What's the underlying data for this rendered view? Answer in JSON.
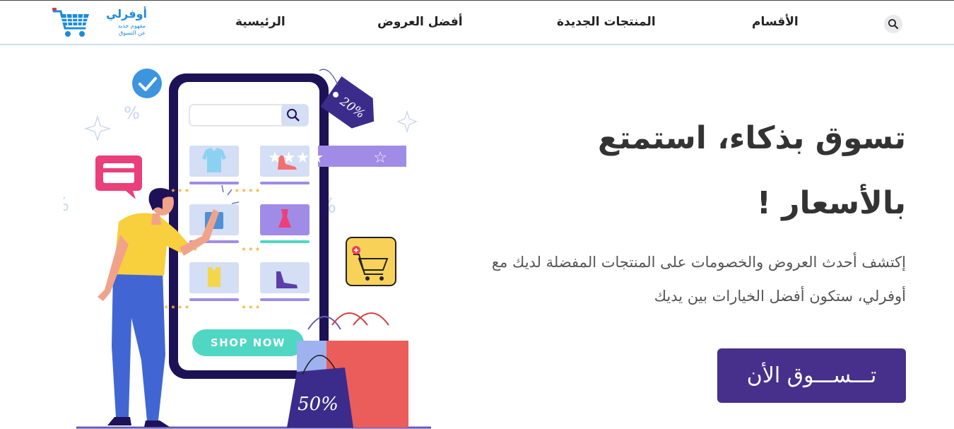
{
  "header": {
    "logo": {
      "title": "أوفرلي",
      "tagline_line1": "مفهوم جديد",
      "tagline_line2": "عن التسوق"
    },
    "nav": [
      {
        "label": "الرئيسية"
      },
      {
        "label": "أفضل العروض"
      },
      {
        "label": "المنتجات الجديدة"
      },
      {
        "label": "الأقسام"
      }
    ]
  },
  "hero": {
    "title": "تسوق بذكاء، استمتع بالأسعار !",
    "description": "إكتشف أحدث العروض والخصومات على المنتجات المفضلة لديك مع أوفرلي، ستكون أفضل الخيارات بين يديك",
    "cta_label": "تـــســـوق الأن"
  },
  "illustration": {
    "shop_now_label": "SHOP NOW",
    "discount_tag": "20%",
    "bag_label": "50%",
    "rating_stars": 4
  },
  "colors": {
    "brand_blue": "#1d8bdc",
    "cta_purple": "#47308c",
    "phone_frame": "#1e1257",
    "teal": "#4fd7c3"
  }
}
